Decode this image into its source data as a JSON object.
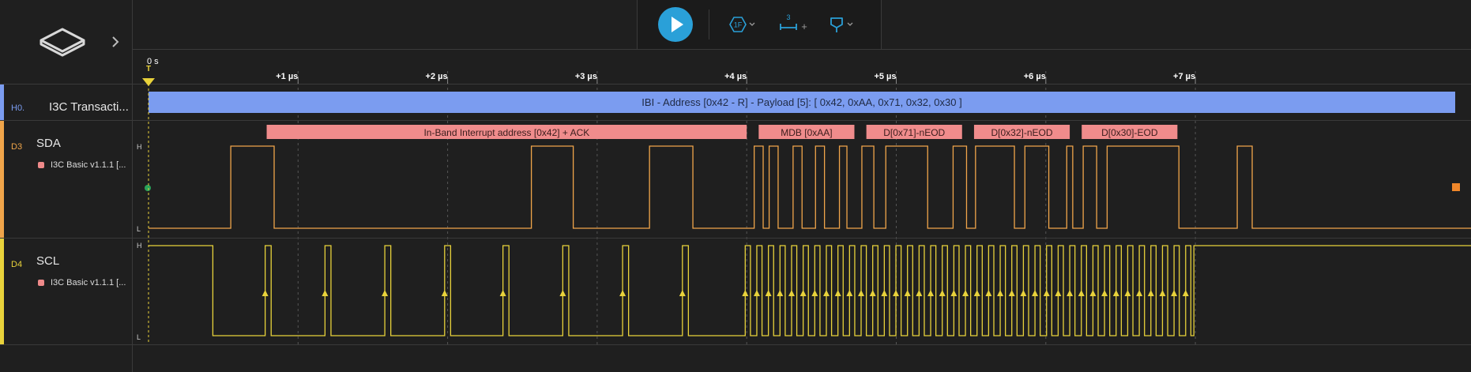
{
  "toolbar": {
    "play_label": "Play",
    "trigger_icon_text": "1F",
    "measure_icon_text": "3",
    "measure_plus": "+"
  },
  "sidebar": {
    "channels": [
      {
        "tag": "H0.",
        "name": "I3C Transacti...",
        "color": "#7b9cf0"
      },
      {
        "tag": "D3",
        "name": "SDA",
        "analyzer": "I3C Basic v1.1.1 [...",
        "color": "#f0a54a"
      },
      {
        "tag": "D4",
        "name": "SCL",
        "analyzer": "I3C Basic v1.1.1 [...",
        "color": "#e8d23b"
      }
    ]
  },
  "timeline": {
    "zero_label": "0 s",
    "trigger_label": "T",
    "ticks": [
      "+1 µs",
      "+2 µs",
      "+3 µs",
      "+4 µs",
      "+5 µs",
      "+6 µs",
      "+7 µs"
    ]
  },
  "levels": {
    "high": "H",
    "low": "L"
  },
  "transaction": {
    "label": "IBI - Address [0x42 - R] - Payload [5]: [ 0x42, 0xAA, 0x71, 0x32, 0x30 ]",
    "color": "#7b9cf0"
  },
  "frames": [
    {
      "label": "In-Band Interrupt address [0x42] + ACK",
      "start_us": 0.79,
      "end_us": 4.0
    },
    {
      "label": "MDB [0xAA]",
      "start_us": 4.08,
      "end_us": 4.72
    },
    {
      "label": "D[0x71]-nEOD",
      "start_us": 4.8,
      "end_us": 5.44
    },
    {
      "label": "D[0x32]-nEOD",
      "start_us": 5.52,
      "end_us": 6.16
    },
    {
      "label": "D[0x30]-EOD",
      "start_us": 6.24,
      "end_us": 6.88
    }
  ],
  "colors": {
    "sda": "#f0a54a",
    "scl": "#e8d23b",
    "frame": "#f08c8c",
    "play": "#2aa0d8",
    "toolbar_icon": "#2aa0d8"
  },
  "signals": {
    "sda_transitions_us": [
      0.55,
      0.84,
      2.56,
      2.84,
      3.35,
      3.64,
      4.05,
      4.11,
      4.15,
      4.21,
      4.31,
      4.37,
      4.46,
      4.52,
      4.62,
      4.67,
      4.77,
      4.85,
      4.93,
      5.21,
      5.38,
      5.47,
      5.53,
      5.79,
      5.86,
      6.02,
      6.14,
      6.18,
      6.25,
      6.34,
      6.41,
      6.89,
      7.28,
      7.38
    ],
    "sda_initial": "L",
    "scl_edges_us": [
      0.42,
      0.8,
      1.2,
      1.6,
      2.0,
      2.39,
      2.79,
      3.19,
      3.59,
      3.99
    ]
  }
}
